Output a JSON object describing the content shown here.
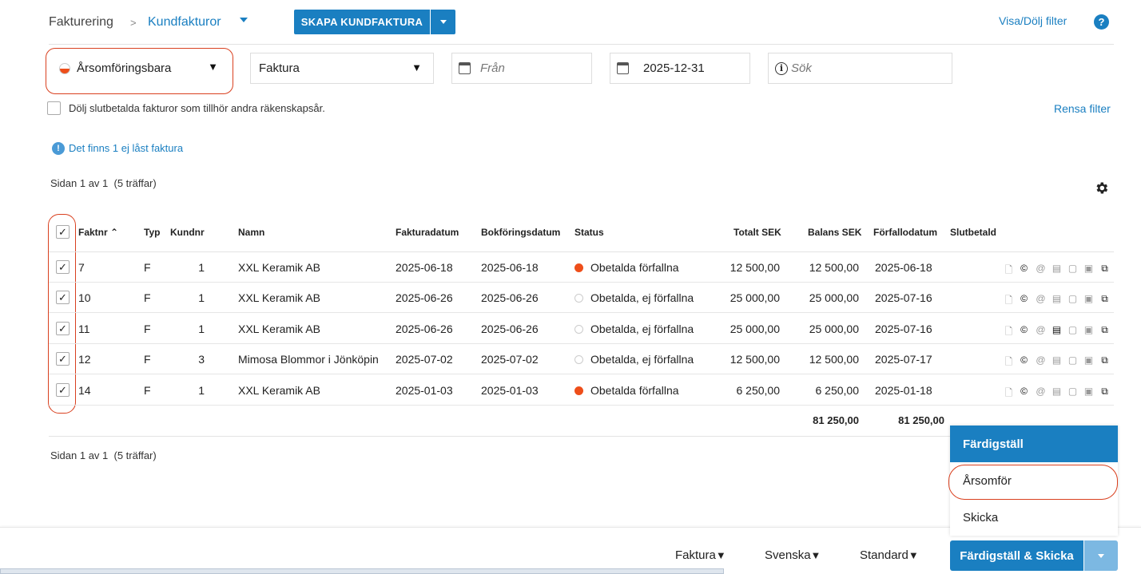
{
  "header": {
    "breadcrumb_root": "Fakturering",
    "breadcrumb_sep": ">",
    "breadcrumb_current": "Kundfakturor",
    "create_button": "SKAPA KUNDFAKTURA",
    "toggle_filter": "Visa/Dölj filter",
    "help": "?"
  },
  "filters": {
    "status_select": "Årsomföringsbara",
    "type_select": "Faktura",
    "date_from_placeholder": "Från",
    "date_to_value": "2025-12-31",
    "search_placeholder": "Sök",
    "hide_paid_label": "Dölj slutbetalda fakturor som tillhör andra räkenskapsår.",
    "clear_filter": "Rensa filter"
  },
  "notice": "Det finns 1 ej låst faktura",
  "pagination_top": "Sidan 1 av 1  (5 träffar)",
  "pagination_bottom": "Sidan 1 av 1  (5 träffar)",
  "table": {
    "columns": {
      "faktnr": "Faktnr",
      "typ": "Typ",
      "kundnr": "Kundnr",
      "namn": "Namn",
      "fakturadatum": "Fakturadatum",
      "bokforingsdatum": "Bokföringsdatum",
      "status": "Status",
      "totalt": "Totalt SEK",
      "balans": "Balans SEK",
      "forfallodatum": "Förfallodatum",
      "slutbetald": "Slutbetald"
    },
    "rows": [
      {
        "faktnr": "7",
        "typ": "F",
        "kundnr": "1",
        "namn": "XXL Keramik AB",
        "fakturadatum": "2025-06-18",
        "bokforingsdatum": "2025-06-18",
        "status": "Obetalda förfallna",
        "status_color": "#ee4e1a",
        "totalt": "12 500,00",
        "balans": "12 500,00",
        "forfallodatum": "2025-06-18"
      },
      {
        "faktnr": "10",
        "typ": "F",
        "kundnr": "1",
        "namn": "XXL Keramik AB",
        "fakturadatum": "2025-06-26",
        "bokforingsdatum": "2025-06-26",
        "status": "Obetalda, ej förfallna",
        "status_color": "empty",
        "totalt": "25 000,00",
        "balans": "25 000,00",
        "forfallodatum": "2025-07-16"
      },
      {
        "faktnr": "11",
        "typ": "F",
        "kundnr": "1",
        "namn": "XXL Keramik AB",
        "fakturadatum": "2025-06-26",
        "bokforingsdatum": "2025-06-26",
        "status": "Obetalda, ej förfallna",
        "status_color": "empty",
        "totalt": "25 000,00",
        "balans": "25 000,00",
        "forfallodatum": "2025-07-16"
      },
      {
        "faktnr": "12",
        "typ": "F",
        "kundnr": "3",
        "namn": "Mimosa Blommor i Jönköpin",
        "fakturadatum": "2025-07-02",
        "bokforingsdatum": "2025-07-02",
        "status": "Obetalda, ej förfallna",
        "status_color": "empty",
        "totalt": "12 500,00",
        "balans": "12 500,00",
        "forfallodatum": "2025-07-17"
      },
      {
        "faktnr": "14",
        "typ": "F",
        "kundnr": "1",
        "namn": "XXL Keramik AB",
        "fakturadatum": "2025-01-03",
        "bokforingsdatum": "2025-01-03",
        "status": "Obetalda förfallna",
        "status_color": "#ee4e1a",
        "totalt": "6 250,00",
        "balans": "6 250,00",
        "forfallodatum": "2025-01-18"
      }
    ],
    "sum_totalt": "81 250,00",
    "sum_balans": "81 250,00"
  },
  "menu": {
    "items": [
      "Färdigställ",
      "Årsomför",
      "Skicka"
    ]
  },
  "footer": {
    "doc_type": "Faktura",
    "language": "Svenska",
    "template": "Standard",
    "primary_button": "Färdigställ & Skicka"
  },
  "colors": {
    "accent": "#1a7fc1",
    "overdue": "#ee4e1a",
    "highlight_outline": "#d9401f"
  }
}
